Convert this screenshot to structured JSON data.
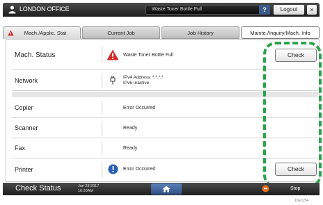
{
  "header": {
    "title": "LONDON OFFICE",
    "alert": "Waste Toner Bottle Full",
    "help_label": "?",
    "logout_label": "Logout",
    "close_label": "×"
  },
  "tabs": [
    {
      "label": "Mach./Applic. Stat",
      "active": true,
      "warning": true
    },
    {
      "label": "Current Job",
      "active": false
    },
    {
      "label": "Job History",
      "active": false
    },
    {
      "label": "Mainte./Inquiry/Mach. Info",
      "active": false
    }
  ],
  "status": {
    "machine": {
      "label": "Mach. Status",
      "value": "Waste Toner Bottle Full",
      "icon": "warning-triangle-icon",
      "action": "Check"
    },
    "network": {
      "label": "Network",
      "line1": "IPv4 Address: *.*.*.*",
      "line2": "IPv6 Inactive",
      "icon": "network-plug-icon"
    },
    "functions": [
      {
        "label": "Copier",
        "value": "Error Occurred"
      },
      {
        "label": "Scanner",
        "value": "Ready"
      },
      {
        "label": "Fax",
        "value": "Ready"
      },
      {
        "label": "Printer",
        "value": "Error Occurred",
        "icon": "info-circle-icon",
        "action": "Check"
      }
    ]
  },
  "bottom": {
    "check_status_label": "Check Status",
    "date": "Jan 28 2017",
    "time": "10:30AM",
    "stop_label": "Stop"
  },
  "figure_code": "DGC254"
}
